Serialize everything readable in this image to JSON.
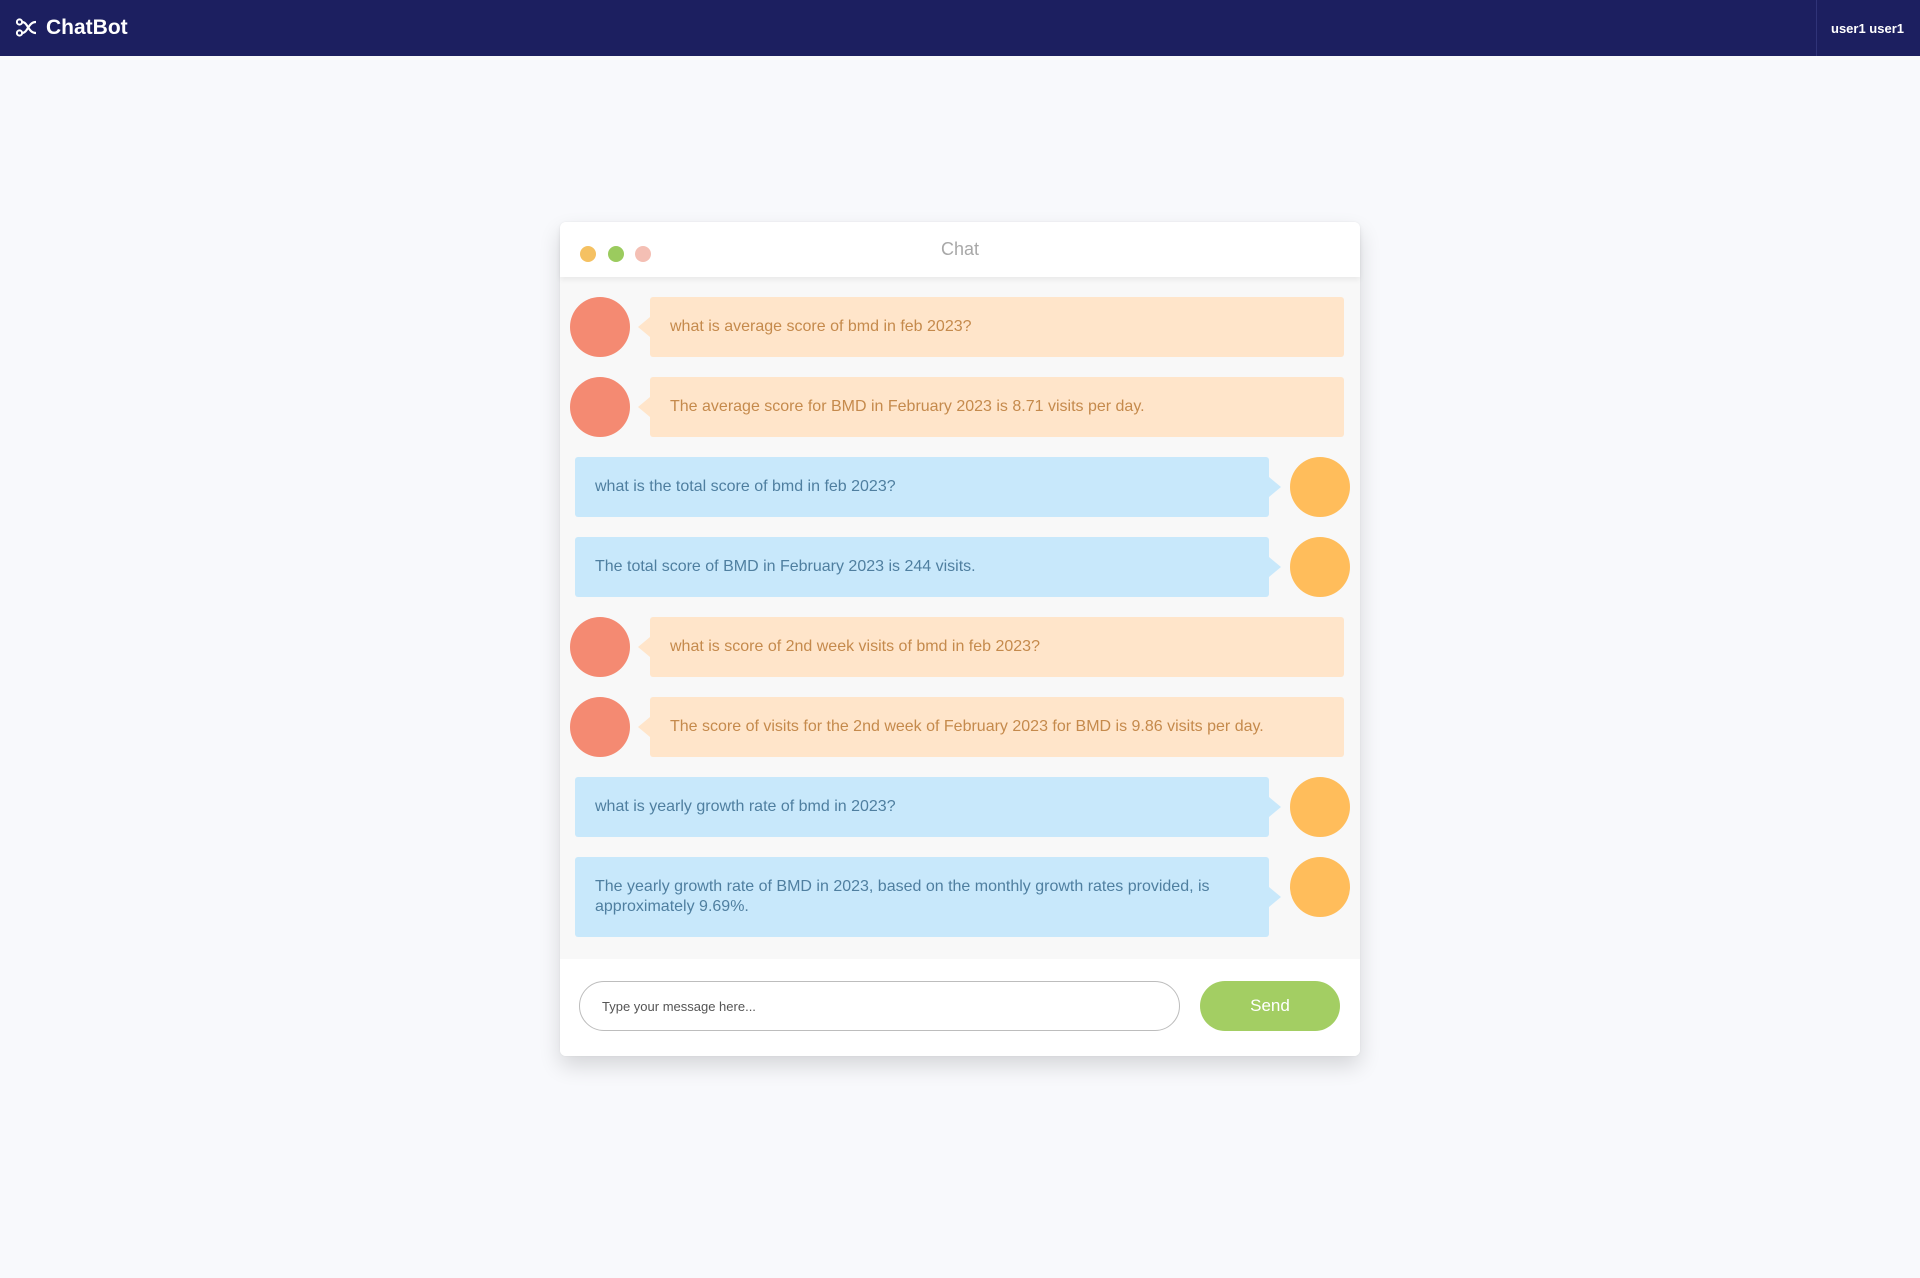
{
  "navbar": {
    "brand": "ChatBot",
    "brand_icon": "connection-icon",
    "user": "user1 user1"
  },
  "chat": {
    "title": "Chat",
    "window_dots": [
      "#f5c162",
      "#9bcb5e",
      "#f4bfb4"
    ],
    "messages": [
      {
        "side": "left",
        "text": "what is average score of bmd in feb 2023?"
      },
      {
        "side": "left",
        "text": "The average score for BMD in February 2023 is 8.71 visits per day."
      },
      {
        "side": "right",
        "text": "what is the total score of bmd in feb 2023?"
      },
      {
        "side": "right",
        "text": "The total score of BMD in February 2023 is 244 visits."
      },
      {
        "side": "left",
        "text": "what is score of 2nd week visits of bmd in feb 2023?"
      },
      {
        "side": "left",
        "text": "The score of visits for the 2nd week of February 2023 for BMD is 9.86 visits per day."
      },
      {
        "side": "right",
        "text": "what is yearly growth rate of bmd in 2023?"
      },
      {
        "side": "right",
        "text": "The yearly growth rate of BMD in 2023, based on the monthly growth rates provided, is approximately 9.69%."
      }
    ],
    "input_placeholder": "Type your message here...",
    "input_value": "",
    "send_label": "Send"
  },
  "colors": {
    "navbar_bg": "#1c1f60",
    "left_avatar": "#f48a72",
    "left_bubble": "#ffe5ca",
    "right_avatar": "#ffbd5b",
    "right_bubble": "#c8e8fb",
    "send_button": "#a3ce63"
  }
}
